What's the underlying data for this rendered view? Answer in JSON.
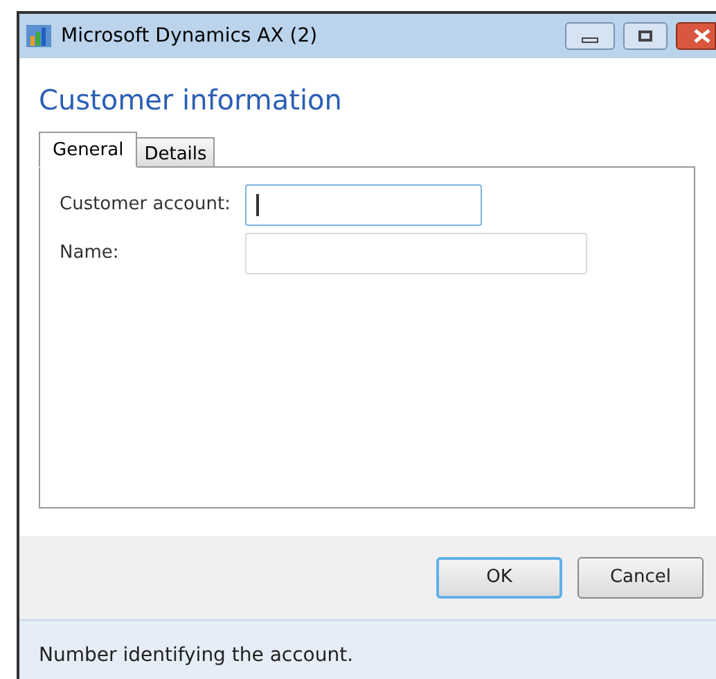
{
  "window": {
    "title": "Microsoft Dynamics AX (2)"
  },
  "heading": "Customer information",
  "tabs": [
    {
      "label": "General",
      "selected": true
    },
    {
      "label": "Details",
      "selected": false
    }
  ],
  "fields": [
    {
      "label": "Customer account:",
      "focused": true,
      "wide": false
    },
    {
      "label": "Name:",
      "focused": false,
      "wide": true
    }
  ],
  "buttons": [
    {
      "label": "OK",
      "default": true
    },
    {
      "label": "Cancel",
      "default": false
    }
  ],
  "status_bar": "Number identifying the account."
}
